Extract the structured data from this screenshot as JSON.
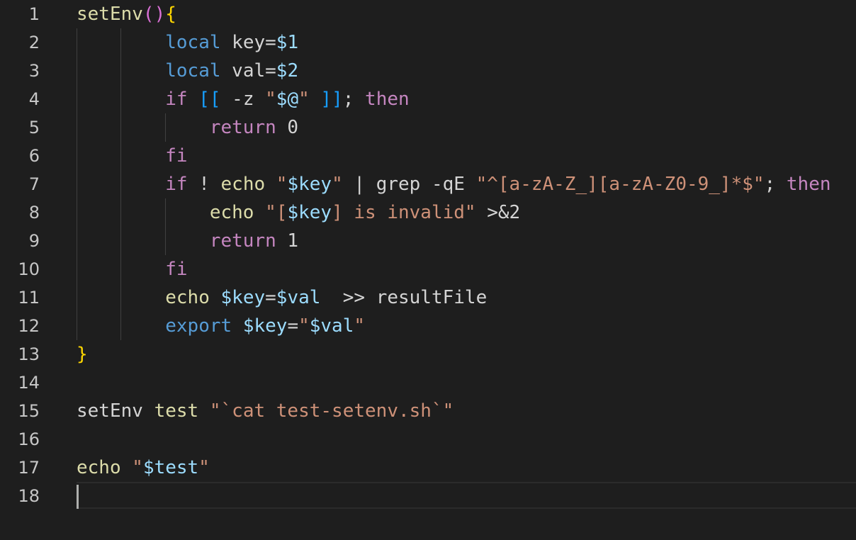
{
  "colors": {
    "background": "#1e1e1e",
    "line_number": "#c6c6c6",
    "default_text": "#d4d4d4",
    "function": "#dcdcaa",
    "keyword": "#569cd6",
    "control": "#c586c0",
    "variable": "#9cdcfe",
    "string": "#ce9178",
    "brace": "#ffd700",
    "paren": "#da70d6"
  },
  "editor": {
    "language": "shell",
    "cursor_line": 18,
    "line_numbers": [
      "1",
      "2",
      "3",
      "4",
      "5",
      "6",
      "7",
      "8",
      "9",
      "10",
      "11",
      "12",
      "13",
      "14",
      "15",
      "16",
      "17",
      "18"
    ],
    "lines": [
      [
        [
          "fn",
          "setEnv"
        ],
        [
          "paren",
          "()"
        ],
        [
          "brace",
          "{"
        ]
      ],
      [
        [
          "ws",
          "        "
        ],
        [
          "kw",
          "local"
        ],
        [
          "op",
          " key="
        ],
        [
          "var",
          "$1"
        ]
      ],
      [
        [
          "ws",
          "        "
        ],
        [
          "kw",
          "local"
        ],
        [
          "op",
          " val="
        ],
        [
          "var",
          "$2"
        ]
      ],
      [
        [
          "ws",
          "        "
        ],
        [
          "ctl",
          "if"
        ],
        [
          "op",
          " "
        ],
        [
          "bracket",
          "[["
        ],
        [
          "op",
          " -z "
        ],
        [
          "str",
          "\""
        ],
        [
          "var",
          "$@"
        ],
        [
          "str",
          "\""
        ],
        [
          "op",
          " "
        ],
        [
          "bracket",
          "]]"
        ],
        [
          "op",
          "; "
        ],
        [
          "ctl",
          "then"
        ]
      ],
      [
        [
          "ws",
          "            "
        ],
        [
          "ctl",
          "return"
        ],
        [
          "op",
          " 0"
        ]
      ],
      [
        [
          "ws",
          "        "
        ],
        [
          "ctl",
          "fi"
        ]
      ],
      [
        [
          "ws",
          "        "
        ],
        [
          "ctl",
          "if"
        ],
        [
          "op",
          " ! "
        ],
        [
          "fn",
          "echo"
        ],
        [
          "op",
          " "
        ],
        [
          "str",
          "\""
        ],
        [
          "var",
          "$key"
        ],
        [
          "str",
          "\""
        ],
        [
          "op",
          " | grep -qE "
        ],
        [
          "str",
          "\"^[a-zA-Z_][a-zA-Z0-9_]*$\""
        ],
        [
          "op",
          "; "
        ],
        [
          "ctl",
          "then"
        ]
      ],
      [
        [
          "ws",
          "            "
        ],
        [
          "fn",
          "echo"
        ],
        [
          "op",
          " "
        ],
        [
          "str",
          "\"["
        ],
        [
          "var",
          "$key"
        ],
        [
          "str",
          "] is invalid\""
        ],
        [
          "op",
          " >&2"
        ]
      ],
      [
        [
          "ws",
          "            "
        ],
        [
          "ctl",
          "return"
        ],
        [
          "op",
          " 1"
        ]
      ],
      [
        [
          "ws",
          "        "
        ],
        [
          "ctl",
          "fi"
        ]
      ],
      [
        [
          "ws",
          "        "
        ],
        [
          "fn",
          "echo"
        ],
        [
          "op",
          " "
        ],
        [
          "var",
          "$key"
        ],
        [
          "op",
          "="
        ],
        [
          "var",
          "$val"
        ],
        [
          "op",
          "  >> resultFile"
        ]
      ],
      [
        [
          "ws",
          "        "
        ],
        [
          "kw",
          "export"
        ],
        [
          "op",
          " "
        ],
        [
          "var",
          "$key"
        ],
        [
          "op",
          "="
        ],
        [
          "str",
          "\""
        ],
        [
          "var",
          "$val"
        ],
        [
          "str",
          "\""
        ]
      ],
      [
        [
          "brace",
          "}"
        ]
      ],
      [],
      [
        [
          "op",
          "setEnv "
        ],
        [
          "fn",
          "test"
        ],
        [
          "op",
          " "
        ],
        [
          "str",
          "\"`cat test-setenv.sh`\""
        ]
      ],
      [],
      [
        [
          "fn",
          "echo"
        ],
        [
          "op",
          " "
        ],
        [
          "str",
          "\""
        ],
        [
          "var",
          "$test"
        ],
        [
          "str",
          "\""
        ]
      ],
      []
    ]
  }
}
